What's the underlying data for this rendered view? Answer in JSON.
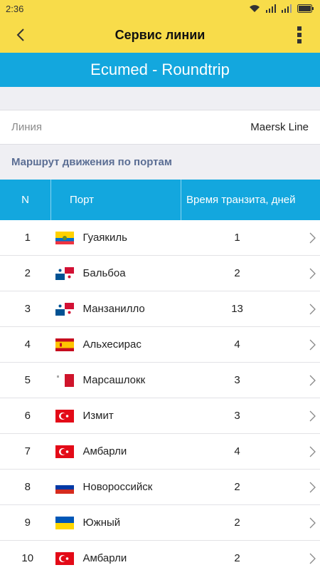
{
  "status_bar": {
    "time": "2:36"
  },
  "app_bar": {
    "title": "Сервис линии"
  },
  "banner": {
    "title": "Ecumed - Roundtrip"
  },
  "line_info": {
    "label": "Линия",
    "value": "Maersk Line"
  },
  "route": {
    "section_title": "Маршрут движения по портам"
  },
  "table": {
    "col_n": "N",
    "col_port": "Порт",
    "col_transit": "Время транзита, дней",
    "rows": [
      {
        "n": "1",
        "port": "Гуаякиль",
        "flag": "ecuador",
        "days": "1"
      },
      {
        "n": "2",
        "port": "Бальбоа",
        "flag": "panama",
        "days": "2"
      },
      {
        "n": "3",
        "port": "Манзанилло",
        "flag": "panama",
        "days": "13"
      },
      {
        "n": "4",
        "port": "Альхесирас",
        "flag": "spain",
        "days": "4"
      },
      {
        "n": "5",
        "port": "Марсашлокк",
        "flag": "malta",
        "days": "3"
      },
      {
        "n": "6",
        "port": "Измит",
        "flag": "turkey",
        "days": "3"
      },
      {
        "n": "7",
        "port": "Амбарли",
        "flag": "turkey",
        "days": "4"
      },
      {
        "n": "8",
        "port": "Новороссийск",
        "flag": "russia",
        "days": "2"
      },
      {
        "n": "9",
        "port": "Южный",
        "flag": "ukraine",
        "days": "2"
      },
      {
        "n": "10",
        "port": "Амбарли",
        "flag": "turkey",
        "days": "2"
      }
    ]
  },
  "colors": {
    "app_bar": "#f8dc4a",
    "accent": "#13a7de",
    "section_text": "#5b6e94"
  }
}
